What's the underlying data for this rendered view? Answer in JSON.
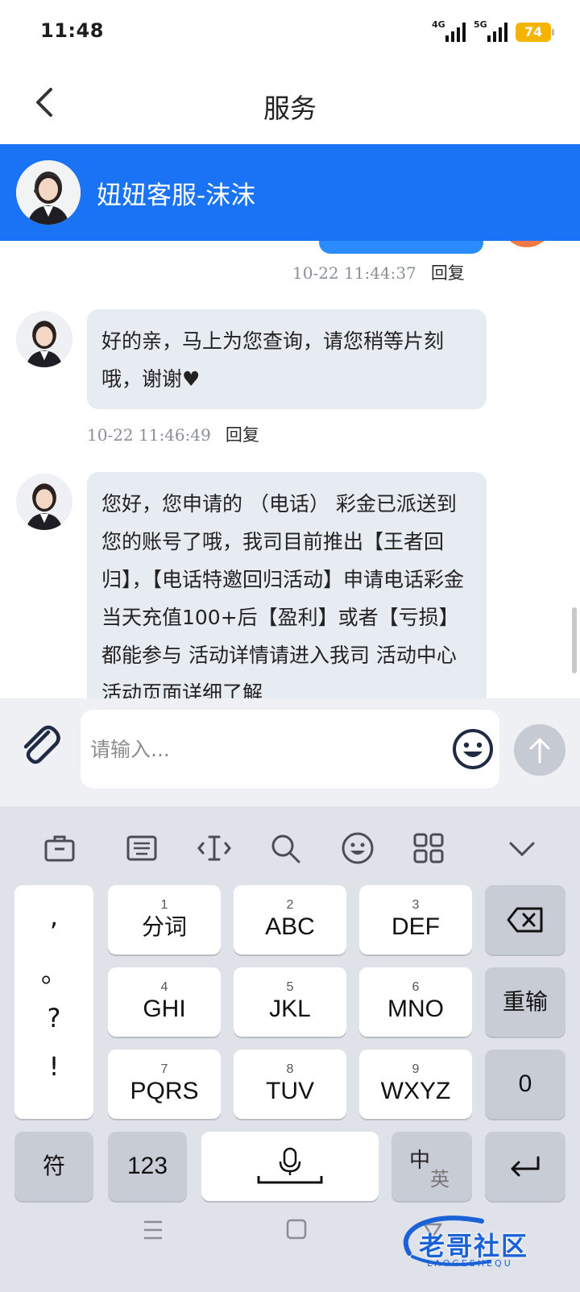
{
  "status_bar": {
    "time": "11:48",
    "signal1": "4G",
    "signal2": "5G",
    "battery": "74"
  },
  "nav": {
    "title": "服务"
  },
  "agent": {
    "name": "妞妞客服-沫沫"
  },
  "messages": [
    {
      "time": "10-22 11:44:37",
      "reply": "回复"
    },
    {
      "text": "好的亲，马上为您查询，请您稍等片刻哦，谢谢♥",
      "time": "10-22 11:46:49",
      "reply": "回复"
    },
    {
      "text": "您好，您申请的 （电话） 彩金已派送到您的账号了哦，我司目前推出【王者回归】，【电话特邀回归活动】申请电话彩金当天充值100+后【盈利】或者【亏损】都能参与 活动详情请进入我司 活动中心 活动页面详细了解"
    }
  ],
  "input": {
    "placeholder": "请输入..."
  },
  "keyboard": {
    "punct": [
      ",",
      "。",
      "?",
      "!"
    ],
    "keys": [
      {
        "num": "1",
        "label": "分词"
      },
      {
        "num": "2",
        "label": "ABC"
      },
      {
        "num": "3",
        "label": "DEF"
      },
      {
        "num": "4",
        "label": "GHI"
      },
      {
        "num": "5",
        "label": "JKL"
      },
      {
        "num": "6",
        "label": "MNO"
      },
      {
        "num": "7",
        "label": "PQRS"
      },
      {
        "num": "8",
        "label": "TUV"
      },
      {
        "num": "9",
        "label": "WXYZ"
      }
    ],
    "reinput": "重输",
    "zero": "0",
    "symbols": "符",
    "numbers": "123",
    "lang_zh": "中",
    "lang_en": "英"
  },
  "watermark": {
    "text": "老哥社区",
    "sub": "LAOGESHEQU"
  }
}
